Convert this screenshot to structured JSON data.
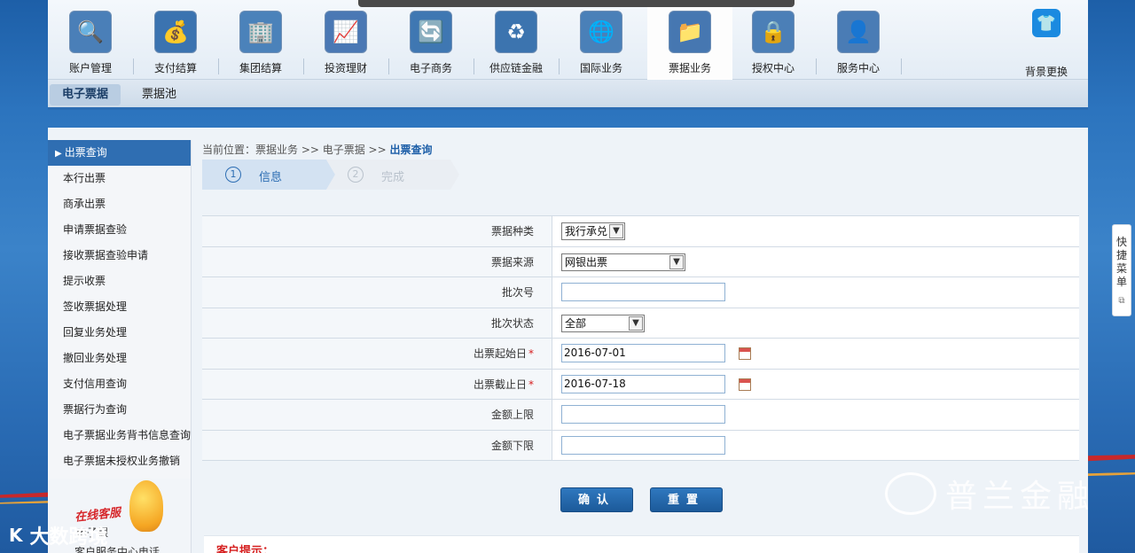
{
  "nav": {
    "items": [
      {
        "label": "账户管理",
        "icon": "magnifier-chart-icon",
        "color": "#4a7fb8"
      },
      {
        "label": "支付结算",
        "icon": "coins-icon",
        "color": "#3b73b0"
      },
      {
        "label": "集团结算",
        "icon": "buildings-icon",
        "color": "#4b82ba"
      },
      {
        "label": "投资理财",
        "icon": "growth-arrow-icon",
        "color": "#4a78b4"
      },
      {
        "label": "电子商务",
        "icon": "globe-arrow-icon",
        "color": "#3f77b2"
      },
      {
        "label": "供应链金融",
        "icon": "cycle-icon",
        "color": "#3c74af"
      },
      {
        "label": "国际业务",
        "icon": "globe-icon",
        "color": "#4a80b8"
      },
      {
        "label": "票据业务",
        "icon": "documents-icon",
        "color": "#4677b1"
      },
      {
        "label": "授权中心",
        "icon": "lock-icon",
        "color": "#4b7fb7"
      },
      {
        "label": "服务中心",
        "icon": "user-service-icon",
        "color": "#4a7cb5"
      }
    ],
    "active_index": 7,
    "skin": {
      "label": "背景更换",
      "icon": "shirt-icon"
    }
  },
  "subtabs": [
    "电子票据",
    "票据池"
  ],
  "sidebar": {
    "items": [
      "出票查询",
      "本行出票",
      "商承出票",
      "申请票据查验",
      "接收票据查验申请",
      "提示收票",
      "签收票据处理",
      "回复业务处理",
      "撤回业务处理",
      "支付信用查询",
      "票据行为查询",
      "电子票据业务背书信息查询",
      "电子票据未授权业务撤销"
    ],
    "service": {
      "title": "在线客服",
      "subtitle": "电子银",
      "phone": "客户服务中心电话"
    }
  },
  "breadcrumb": {
    "prefix": "当前位置：票据业务 >> 电子票据 >> ",
    "current": "出票查询"
  },
  "steps": [
    {
      "num": "1",
      "label": "信息"
    },
    {
      "num": "2",
      "label": "完成"
    }
  ],
  "form": {
    "bill_type": {
      "label": "票据种类",
      "value": "我行承兑"
    },
    "bill_source": {
      "label": "票据来源",
      "value": "网银出票"
    },
    "batch_no": {
      "label": "批次号",
      "value": ""
    },
    "batch_status": {
      "label": "批次状态",
      "value": "全部"
    },
    "start_date": {
      "label": "出票起始日",
      "value": "2016-07-01"
    },
    "end_date": {
      "label": "出票截止日",
      "value": "2016-07-18"
    },
    "amount_max": {
      "label": "金额上限",
      "value": ""
    },
    "amount_min": {
      "label": "金额下限",
      "value": ""
    }
  },
  "buttons": {
    "confirm": "确认",
    "reset": "重置"
  },
  "tips": {
    "label": "客户提示："
  },
  "quickmenu": {
    "label": "快捷菜单"
  },
  "watermarks": {
    "right": "普兰金融",
    "left_logo": "K",
    "left": "大数跨境"
  }
}
